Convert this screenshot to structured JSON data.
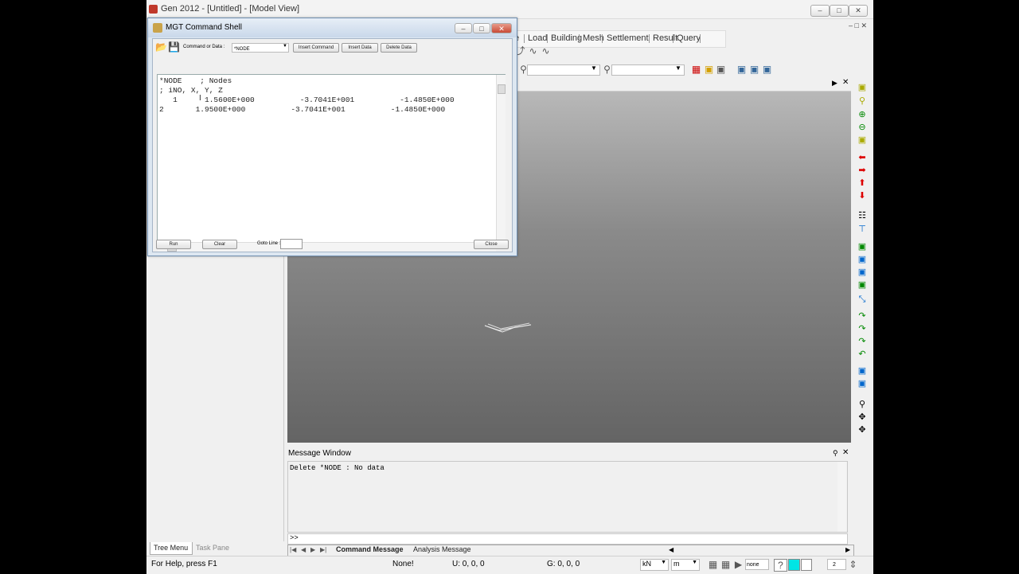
{
  "app": {
    "title": "Gen 2012 - [Untitled] - [Model View]",
    "menus": [
      "e",
      "Load",
      "Building",
      "Mesh",
      "Settlement",
      "Result",
      "Query"
    ]
  },
  "dialog": {
    "title": "MGT Command Shell",
    "command_label": "Command or Data :",
    "command_value": "*NODE",
    "insert_command": "Insert Command",
    "insert_data": "Insert Data",
    "delete_data": "Delete Data",
    "lines": [
      "*NODE    ; Nodes",
      "; iNO, X, Y, Z",
      "   1      1.5600E+000          -3.7041E+001          -1.4850E+000",
      "2       1.9500E+000          -3.7041E+001          -1.4850E+000"
    ],
    "run": "Run",
    "clear": "Clear",
    "goto_line": "Goto Line :",
    "close": "Close"
  },
  "tree_tabs": {
    "tree_menu": "Tree Menu",
    "task_pane": "Task Pane"
  },
  "message_window": {
    "title": "Message Window",
    "text": "Delete *NODE : No data",
    "prompt": ">>",
    "tab_command": "Command Message",
    "tab_analysis": "Analysis Message"
  },
  "status": {
    "help": "For Help, press F1",
    "none": "None!",
    "u": "U: 0, 0, 0",
    "g": "G: 0, 0, 0",
    "force_unit": "kN",
    "length_unit": "m",
    "none_combo": "none",
    "page": "2"
  },
  "colors": {
    "accent_cyan": "#00e5e5",
    "dialog_frame": "#dde7f1"
  }
}
